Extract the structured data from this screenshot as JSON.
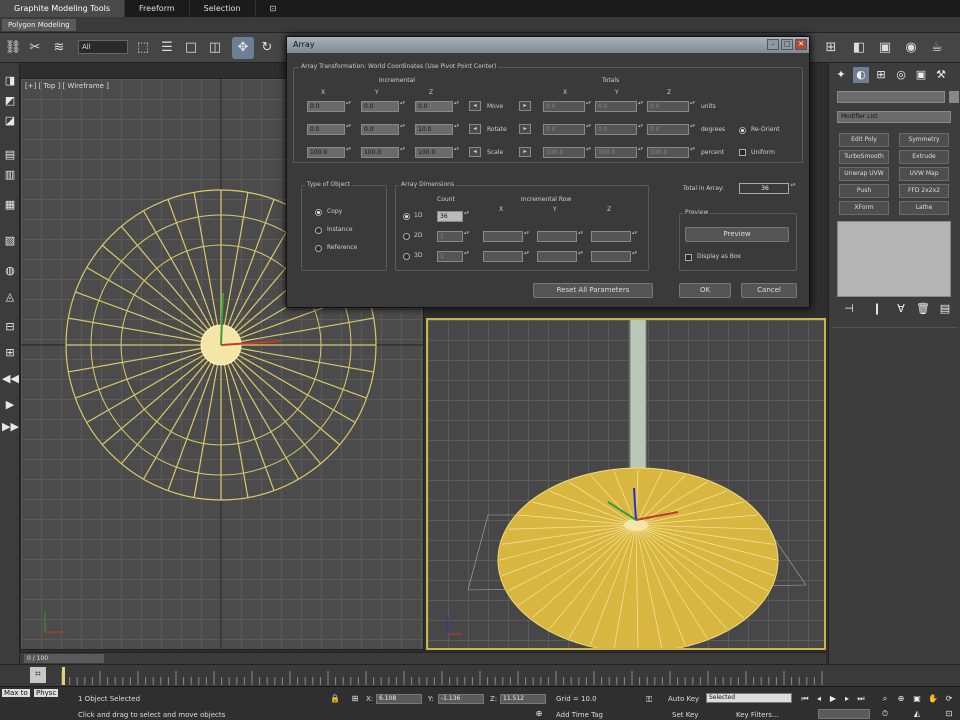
{
  "ribbon": {
    "tabs": [
      "Graphite Modeling Tools",
      "Freeform",
      "Selection"
    ],
    "subtab": "Polygon Modeling"
  },
  "toolbar": {
    "selection_filter": "All"
  },
  "viewport_top": {
    "label": "[+] [ Top ] [ Wireframe ]"
  },
  "dialog": {
    "title": "Array",
    "transform_group": "Array Transformation: World Coordinates (Use Pivot Point Center)",
    "incremental_label": "Incremental",
    "totals_label": "Totals",
    "axes": [
      "X",
      "Y",
      "Z"
    ],
    "rows": [
      {
        "label": "Move",
        "inc": [
          "0.0",
          "0.0",
          "0.0"
        ],
        "tot": [
          "0.0",
          "0.0",
          "0.0"
        ],
        "unit": "units"
      },
      {
        "label": "Rotate",
        "inc": [
          "0.0",
          "0.0",
          "10.0"
        ],
        "tot": [
          "0.0",
          "0.0",
          "0.0"
        ],
        "unit": "degrees"
      },
      {
        "label": "Scale",
        "inc": [
          "100.0",
          "100.0",
          "100.0"
        ],
        "tot": [
          "100.0",
          "100.0",
          "100.0"
        ],
        "unit": "percent"
      }
    ],
    "re_orient": "Re-Orient",
    "uniform": "Uniform",
    "type_group": "Type of Object",
    "types": [
      "Copy",
      "Instance",
      "Reference"
    ],
    "dims_group": "Array Dimensions",
    "count_label": "Count",
    "incremental_row_label": "Incremental Row",
    "dims": [
      {
        "label": "1D",
        "count": "36"
      },
      {
        "label": "2D",
        "count": "1"
      },
      {
        "label": "3D",
        "count": "1"
      }
    ],
    "total_label": "Total in Array:",
    "total_value": "36",
    "preview_group": "Preview",
    "preview_button": "Preview",
    "display_as_box": "Display as Box",
    "reset_button": "Reset All Parameters",
    "ok_button": "OK",
    "cancel_button": "Cancel"
  },
  "command_panel": {
    "modifier_list": "Modifier List",
    "modifiers": [
      "Edit Poly",
      "Symmetry",
      "TurboSmooth",
      "Extrude",
      "Unwrap UVW",
      "UVW Map",
      "Push",
      "FFD 2x2x2",
      "XForm",
      "Lathe"
    ]
  },
  "time_slider": {
    "label": "0 / 100"
  },
  "status": {
    "selected": "1 Object Selected",
    "prompt": "Click and drag to select and move objects",
    "x_label": "X:",
    "x": "6.108",
    "y_label": "Y:",
    "y": "-1.136",
    "z_label": "Z:",
    "z": "11.512",
    "grid": "Grid = 10.0",
    "auto_key": "Auto Key",
    "set_key": "Set Key",
    "key_mode": "Selected",
    "key_filters": "Key Filters...",
    "add_time_tag": "Add Time Tag",
    "mini_listener": [
      "Max to",
      "Physc"
    ]
  }
}
